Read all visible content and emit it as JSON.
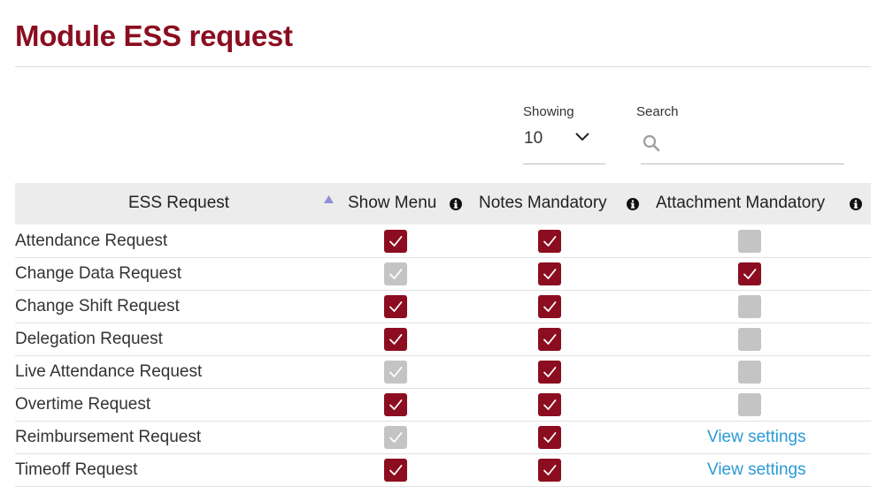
{
  "page": {
    "title": "Module ESS request"
  },
  "controls": {
    "showing_label": "Showing",
    "showing_value": "10",
    "search_label": "Search",
    "search_placeholder": "",
    "search_value": ""
  },
  "table": {
    "headers": {
      "ess_request": "ESS Request",
      "show_menu": "Show Menu",
      "notes_mandatory": "Notes Mandatory",
      "attachment_mandatory": "Attachment Mandatory"
    },
    "sort": {
      "column": "ess_request",
      "direction": "ascending"
    },
    "rows": [
      {
        "label": "Attendance Request",
        "show_menu": true,
        "notes_mandatory": true,
        "attachment_mandatory": false
      },
      {
        "label": "Change Data Request",
        "show_menu": false,
        "notes_mandatory": true,
        "attachment_mandatory": true
      },
      {
        "label": "Change Shift Request",
        "show_menu": true,
        "notes_mandatory": true,
        "attachment_mandatory": false
      },
      {
        "label": "Delegation Request",
        "show_menu": true,
        "notes_mandatory": true,
        "attachment_mandatory": false
      },
      {
        "label": "Live Attendance Request",
        "show_menu": false,
        "notes_mandatory": true,
        "attachment_mandatory": false
      },
      {
        "label": "Overtime Request",
        "show_menu": true,
        "notes_mandatory": true,
        "attachment_mandatory": false
      },
      {
        "label": "Reimbursement Request",
        "show_menu": false,
        "notes_mandatory": true,
        "attachment_mandatory": "View settings"
      },
      {
        "label": "Timeoff Request",
        "show_menu": true,
        "notes_mandatory": true,
        "attachment_mandatory": "View settings"
      }
    ]
  },
  "colors": {
    "brand": "#8b0d1f",
    "checkbox_checked": "#8b0d1f",
    "checkbox_unchecked": "#c4c4c4",
    "link": "#2b9ad6",
    "header_bg": "#ececec"
  },
  "icons": {
    "sort": "triangle-up-icon",
    "info": "info-icon",
    "search": "search-icon",
    "dropdown": "chevron-down-icon",
    "check": "check-icon"
  }
}
